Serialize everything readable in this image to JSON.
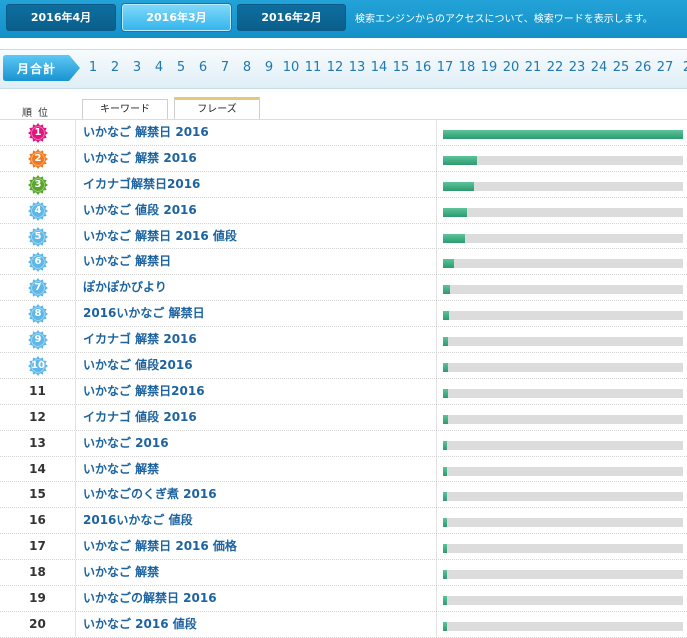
{
  "month_tabs": [
    "2016年4月",
    "2016年3月",
    "2016年2月"
  ],
  "active_month": 1,
  "top_note": "検索エンジンからのアクセスについて、検索ワードを表示します。",
  "month_total_label": "月合計",
  "days": [
    "1",
    "2",
    "3",
    "4",
    "5",
    "6",
    "7",
    "8",
    "9",
    "10",
    "11",
    "12",
    "13",
    "14",
    "15",
    "16",
    "17",
    "18",
    "19",
    "20",
    "21",
    "22",
    "23",
    "24",
    "25",
    "26",
    "27",
    "2"
  ],
  "rank_header": "順位",
  "tabs": {
    "keyword": "キーワード",
    "phrase": "フレーズ"
  },
  "badge_colors": [
    "#e0157f",
    "#f07a1f",
    "#5aa52b",
    "#5fb7e8",
    "#5fb7e8",
    "#5fb7e8",
    "#5fb7e8",
    "#5fb7e8",
    "#5fb7e8",
    "#5fb7e8"
  ],
  "rows": [
    {
      "rank": "1",
      "phrase": "いかなご 解禁日 2016",
      "share": 1.0
    },
    {
      "rank": "2",
      "phrase": "いかなご 解禁 2016",
      "share": 0.14
    },
    {
      "rank": "3",
      "phrase": "イカナゴ解禁日2016",
      "share": 0.13
    },
    {
      "rank": "4",
      "phrase": "いかなご 値段 2016",
      "share": 0.1
    },
    {
      "rank": "5",
      "phrase": "いかなご 解禁日 2016 値段",
      "share": 0.09
    },
    {
      "rank": "6",
      "phrase": "いかなご 解禁日",
      "share": 0.045
    },
    {
      "rank": "7",
      "phrase": "ぽかぽかびより",
      "share": 0.03
    },
    {
      "rank": "8",
      "phrase": "2016いかなご 解禁日",
      "share": 0.025
    },
    {
      "rank": "9",
      "phrase": "イカナゴ 解禁 2016",
      "share": 0.022
    },
    {
      "rank": "10",
      "phrase": "いかなご 値段2016",
      "share": 0.02
    },
    {
      "rank": "11",
      "phrase": "いかなご 解禁日2016",
      "share": 0.02
    },
    {
      "rank": "12",
      "phrase": "イカナゴ 値段 2016",
      "share": 0.02
    },
    {
      "rank": "13",
      "phrase": "いかなご 2016",
      "share": 0.018
    },
    {
      "rank": "14",
      "phrase": "いかなご 解禁",
      "share": 0.018
    },
    {
      "rank": "15",
      "phrase": "いかなごのくぎ煮 2016",
      "share": 0.018
    },
    {
      "rank": "16",
      "phrase": "2016いかなご 値段",
      "share": 0.016
    },
    {
      "rank": "17",
      "phrase": "いかなご 解禁日 2016 価格",
      "share": 0.016
    },
    {
      "rank": "18",
      "phrase": "いかなご 解禁",
      "share": 0.015
    },
    {
      "rank": "19",
      "phrase": "いかなごの解禁日 2016",
      "share": 0.015
    },
    {
      "rank": "20",
      "phrase": "いかなご 2016 値段",
      "share": 0.015
    }
  ]
}
